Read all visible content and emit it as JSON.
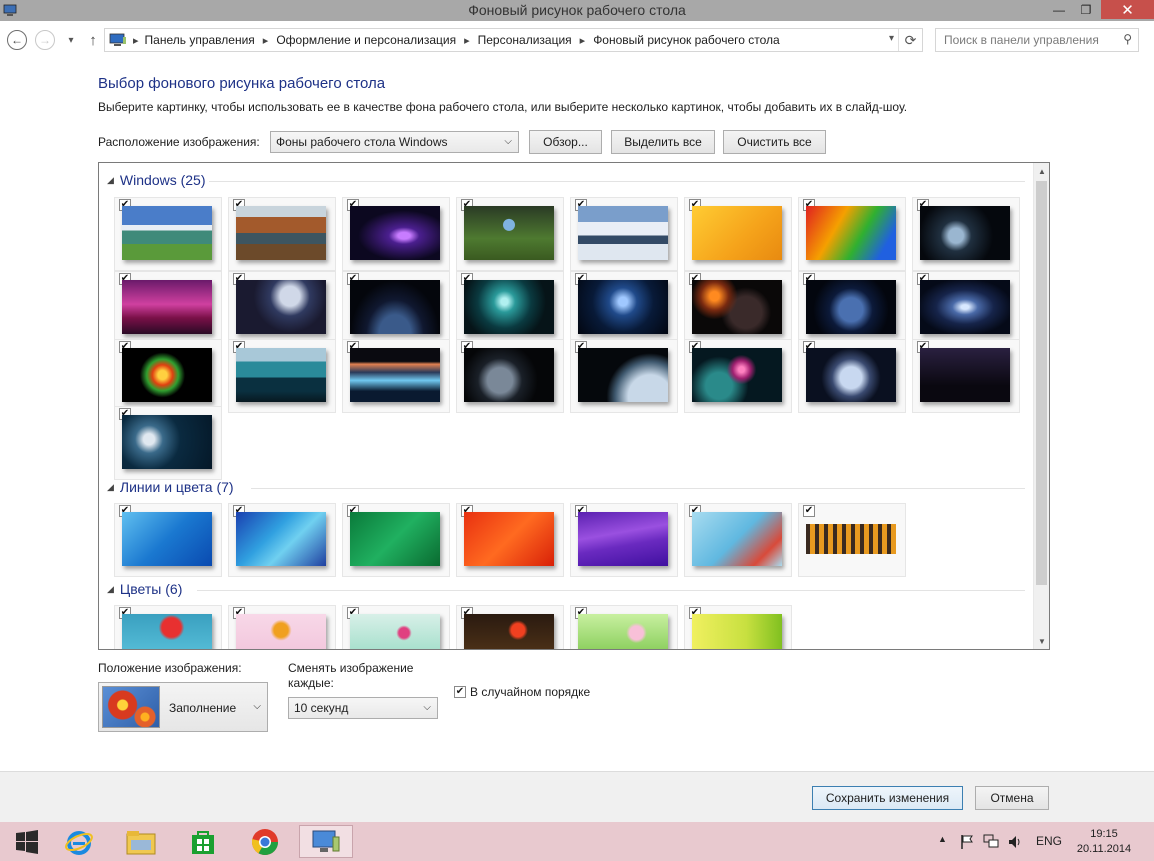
{
  "window": {
    "title": "Фоновый рисунок рабочего стола",
    "minimize": "—",
    "maximize": "❐",
    "close": "✕"
  },
  "nav": {
    "back": "←",
    "forward": "→",
    "recent": "▾",
    "up": "↑",
    "breadcrumbs": [
      "Панель управления",
      "Оформление и персонализация",
      "Персонализация",
      "Фоновый рисунок рабочего стола"
    ],
    "separator": "▸",
    "address_dropdown": "▾",
    "refresh": "⟳",
    "search_placeholder": "Поиск в панели управления",
    "search_icon": "⚲"
  },
  "main": {
    "heading": "Выбор фонового рисунка рабочего стола",
    "subtitle": "Выберите картинку, чтобы использовать ее в качестве фона рабочего стола, или выберите несколько картинок, чтобы добавить их в слайд-шоу.",
    "location_label": "Расположение изображения:",
    "location_value": "Фоны рабочего стола Windows",
    "browse_button": "Обзор...",
    "select_all_button": "Выделить все",
    "clear_all_button": "Очистить все"
  },
  "gallery": {
    "groups": [
      {
        "title": "Windows (25)",
        "count": 25
      },
      {
        "title": "Линии и цвета (7)",
        "count": 7
      },
      {
        "title": "Цветы (6)",
        "count": 6
      }
    ],
    "check_mark": "✔",
    "collapse_glyph": "◢"
  },
  "settings": {
    "position_label": "Положение изображения:",
    "position_value": "Заполнение",
    "interval_label": "Сменять изображение каждые:",
    "interval_value": "10 секунд",
    "shuffle_label": "В случайном порядке",
    "shuffle_checked": true
  },
  "footer": {
    "save_button": "Сохранить изменения",
    "cancel_button": "Отмена"
  },
  "taskbar": {
    "tray_up": "▲",
    "language": "ENG",
    "time": "19:15",
    "date": "20.11.2014"
  },
  "colors": {
    "accent_heading": "#1e3287",
    "close_button": "#c7504b",
    "taskbar": "#e8c9cf"
  }
}
